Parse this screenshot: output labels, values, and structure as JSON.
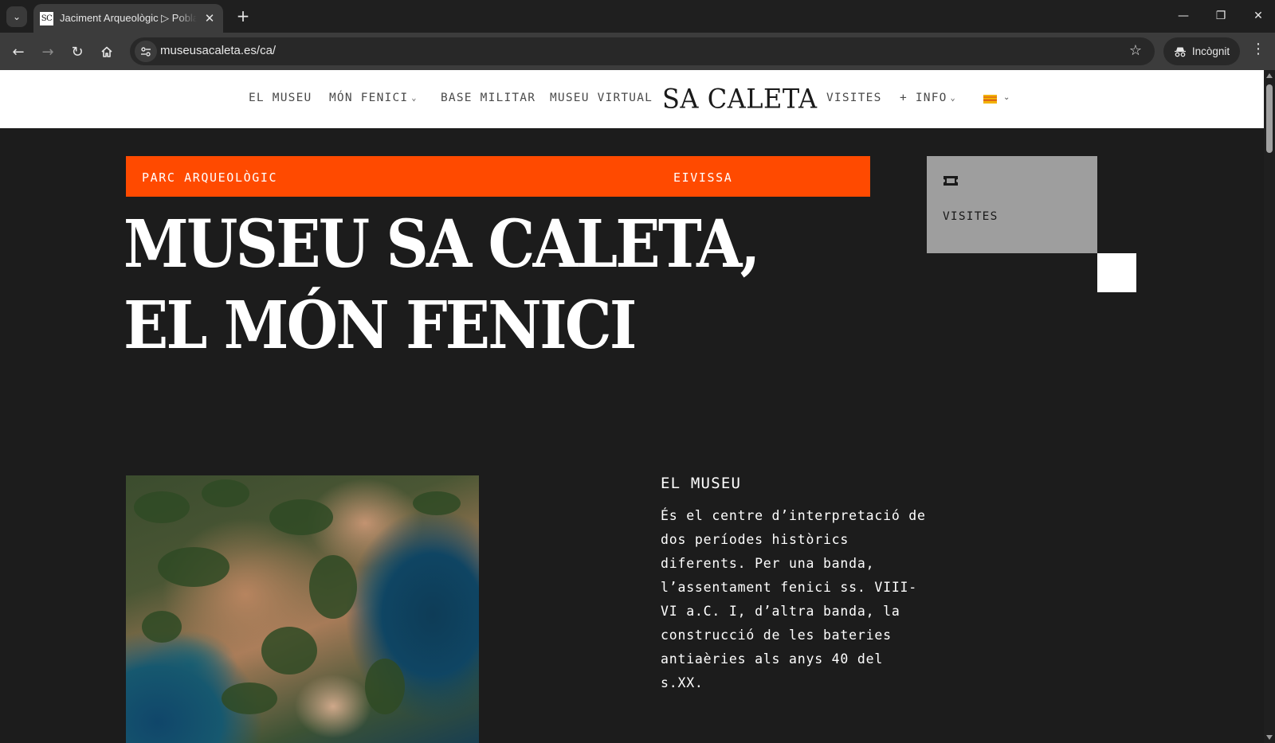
{
  "browser": {
    "tab_title": "Jaciment Arqueològic ▷ Poblat",
    "favicon_text": "SC",
    "url": "museusacaleta.es/ca/",
    "profile_label": "Incògnit"
  },
  "site": {
    "logo": "SA CALETA",
    "nav_left": [
      "EL MUSEU",
      "MÓN FENICI",
      "BASE MILITAR",
      "MUSEU VIRTUAL"
    ],
    "nav_right": [
      "VISITES",
      "+ INFO"
    ],
    "flag_colors": [
      "#f2b205",
      "#d6461a"
    ]
  },
  "hero": {
    "band_left": "PARC ARQUEOLÒGIC",
    "band_right": "EIVISSA",
    "title_line1": "MUSEU SA CALETA,",
    "title_line2": "EL MÓN FENICI",
    "accent_color": "#ff4a00"
  },
  "visit_card": {
    "label": "VISITES",
    "icon": "ticket-icon"
  },
  "museu": {
    "heading": "EL MUSEU",
    "lines": [
      "És el centre d’interpretació de",
      "dos períodes històrics",
      "diferents. Per una banda,",
      "l’assentament fenici ss. VIII-",
      "VI a.C. I, d’altra banda, la",
      "construcció de les bateries",
      "antiaèries als anys 40 del",
      "s.XX."
    ]
  }
}
